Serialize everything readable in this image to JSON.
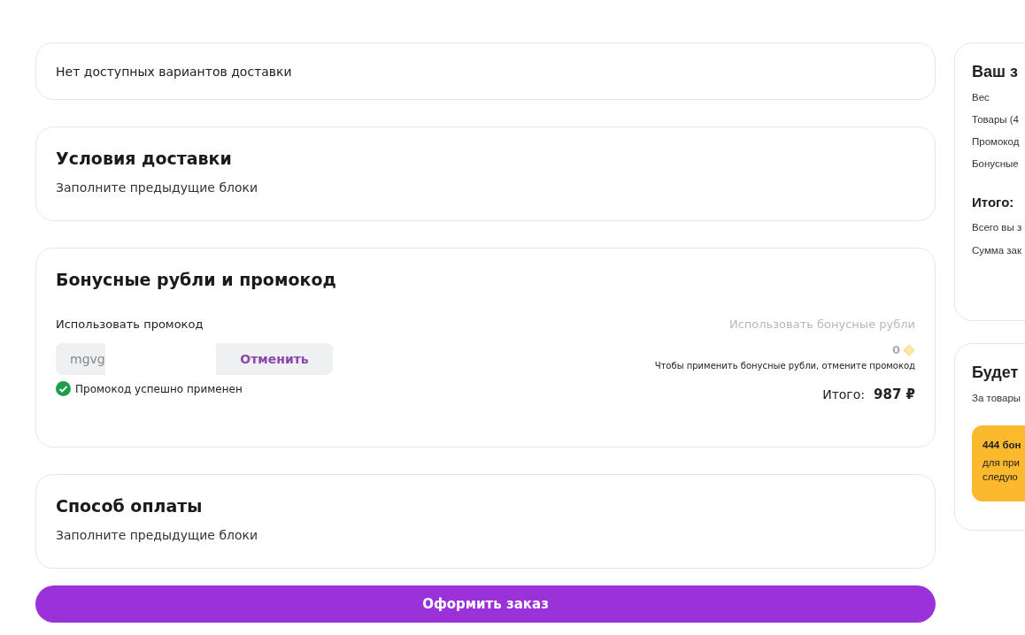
{
  "delivery_options": {
    "message": "Нет доступных вариантов доставки"
  },
  "delivery_conditions": {
    "title": "Условия доставки",
    "hint": "Заполните предыдущие блоки"
  },
  "bonus_promo": {
    "title": "Бонусные рубли и промокод",
    "promo_label": "Использовать промокод",
    "promo_value": "mgvg",
    "cancel_button": "Отменить",
    "success_message": "Промокод успешно применен",
    "bonus_label": "Использовать бонусные рубли",
    "bonus_disabled": true,
    "bonus_amount": "0",
    "bonus_note": "Чтобы применить бонусные рубли, отмените промокод",
    "total_label": "Итого:",
    "total_value": "987 ₽"
  },
  "payment": {
    "title": "Способ оплаты",
    "hint": "Заполните предыдущие блоки"
  },
  "submit_button": "Оформить заказ",
  "order_summary": {
    "title": "Ваш з",
    "rows": [
      "Вес",
      "Товары (4",
      "Промокод",
      "Бонусные"
    ],
    "total_title": "Итого:",
    "total_rows": [
      "Всего вы з",
      "Сумма зак"
    ]
  },
  "bonus_earn": {
    "title": "Будет",
    "subtitle": "За товары",
    "banner_title": "444 бон",
    "banner_lines": [
      "для при",
      "следую"
    ]
  }
}
